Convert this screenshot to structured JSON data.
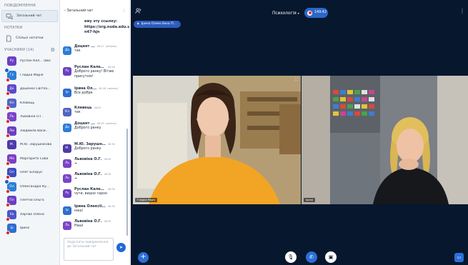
{
  "left_panel": {
    "messages_header": "ПОВІДОМЛЕННЯ",
    "public_chat_label": "Загальний чат",
    "notes_header": "НОТАТКИ",
    "shared_notes_label": "Спільні нотатки",
    "users_header": "УЧАСНИКИ (14)",
    "users": [
      {
        "initials": "Ру",
        "name": "Руслан Кал... (Ви)",
        "color": "#6a3fc4",
        "muted": false,
        "moderator": false
      },
      {
        "initials": "Гл",
        "name": "Гладка Марія",
        "color": "#2a7dd8",
        "muted": true,
        "moderator": true
      },
      {
        "initials": "Де",
        "name": "Доценко Світла...",
        "color": "#5d4ac9",
        "muted": true,
        "moderator": false
      },
      {
        "initials": "Кл",
        "name": "Клевець",
        "color": "#5263c4",
        "muted": true,
        "moderator": false
      },
      {
        "initials": "Ль",
        "name": "Львовіна О.Г.",
        "color": "#7a44c8",
        "muted": true,
        "moderator": false
      },
      {
        "initials": "Лю",
        "name": "Людмила Васи...",
        "color": "#6b3fc0",
        "muted": true,
        "moderator": false
      },
      {
        "initials": "М.",
        "name": "М.Ю. Зарушнікова",
        "color": "#4f3aa8",
        "muted": false,
        "moderator": false
      },
      {
        "initials": "Ма",
        "name": "Маргарита Сова",
        "color": "#7c3fc2",
        "muted": true,
        "moderator": false
      },
      {
        "initials": "Ол",
        "name": "Олег Білорус",
        "color": "#3c4dbf",
        "muted": true,
        "moderator": false
      },
      {
        "initials": "Ол",
        "name": "Олександра Ку...",
        "color": "#2b7fd6",
        "muted": true,
        "moderator": true
      },
      {
        "initials": "Пл",
        "name": "Плетна Ольга",
        "color": "#6b3fc4",
        "muted": true,
        "moderator": false
      },
      {
        "initials": "Ха",
        "name": "Харчва Олена",
        "color": "#4c56c8",
        "muted": true,
        "moderator": false
      },
      {
        "initials": "Ір",
        "name": "Ірина",
        "color": "#2f6ed0",
        "muted": true,
        "moderator": false
      }
    ]
  },
  "chat": {
    "back_label": "‹  Загальний чат",
    "menu_label": "⋮",
    "link_text": "ему эту ссылку: https://org.nuda.edu.ua/b/adm-n47-hjn",
    "messages": [
      {
        "initials": "До",
        "color": "#2a7dd8",
        "name": "Доцент ...",
        "time": "08:27",
        "edited": "(змінено)",
        "text": "так"
      },
      {
        "initials": "Ру",
        "color": "#6a3fc4",
        "name": "Руслан Калени...",
        "time": "08:28",
        "edited": "",
        "text": "Доброго ранку! Вітаю присутніх!"
      },
      {
        "initials": "Ір",
        "color": "#2f6ed0",
        "name": "Ірина Ол...",
        "time": "08:28",
        "edited": "(змінено)",
        "text": "Все добре"
      },
      {
        "initials": "Кл",
        "color": "#5263c4",
        "name": "Клевець",
        "time": "08:29",
        "edited": "",
        "text": "так"
      },
      {
        "initials": "До",
        "color": "#2a7dd8",
        "name": "Доцент ...",
        "time": "08:29",
        "edited": "(змінено)",
        "text": "Доброго ранку"
      },
      {
        "initials": "М.",
        "color": "#4f3aa8",
        "name": "М.Ю. Зарушнікова",
        "time": "08:30",
        "edited": "",
        "text": "Доброго ранку"
      },
      {
        "initials": "Ль",
        "color": "#7a44c8",
        "name": "Львовіна О.Г.",
        "time": "08:30",
        "edited": "",
        "text": "+"
      },
      {
        "initials": "Ль",
        "color": "#7a44c8",
        "name": "Львовіна О.Г.",
        "time": "08:30",
        "edited": "",
        "text": "+"
      },
      {
        "initials": "Ру",
        "color": "#6a3fc4",
        "name": "Руслан Калени...",
        "time": "08:34",
        "edited": "",
        "text": "чути, видно гарно"
      },
      {
        "initials": "Ір",
        "color": "#2f6ed0",
        "name": "Ірина Олексіїв...",
        "time": "08:35",
        "edited": "",
        "text": "наші"
      },
      {
        "initials": "Ль",
        "color": "#7a44c8",
        "name": "Львовіна О.Г.",
        "time": "08:35",
        "edited": "",
        "text": "Наші"
      }
    ],
    "input_placeholder": "Надіслати повідомлення до Загальний чат"
  },
  "main": {
    "title": "Психологія",
    "recording_time": "149:42",
    "presenter_label": "Ірина Олексіївна П...",
    "videos": [
      {
        "label": "Гладка Марія"
      },
      {
        "label": "Ірина"
      }
    ]
  },
  "icons": {
    "chat": "chat-bubbles-icon",
    "notes": "notes-icon",
    "settings": "gear-icon",
    "users": "users-icon",
    "record": "record-icon",
    "lock": "lock-icon",
    "plus": "plus-icon",
    "mic": "mic-off-icon",
    "phone": "phone-icon",
    "camera": "camera-off-icon",
    "screen": "screen-share-icon",
    "send": "send-icon",
    "expand": "expand-icon"
  }
}
